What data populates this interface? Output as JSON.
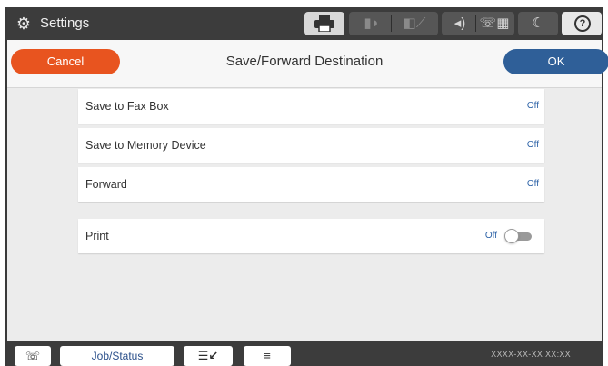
{
  "topbar": {
    "title": "Settings",
    "icons": {
      "settings": "gear-icon",
      "printer": "printer-icon",
      "wifi": "wifi-icon",
      "wifi_direct": "wifi-direct-icon",
      "volume": "volume-icon",
      "fax": "fax-icon",
      "sleep": "moon-icon",
      "help": "help-icon"
    },
    "help_glyph": "?"
  },
  "header": {
    "cancel_label": "Cancel",
    "title": "Save/Forward Destination",
    "ok_label": "OK"
  },
  "items": [
    {
      "label": "Save to Fax Box",
      "value": "Off"
    },
    {
      "label": "Save to Memory Device",
      "value": "Off"
    },
    {
      "label": "Forward",
      "value": "Off"
    }
  ],
  "print": {
    "label": "Print",
    "value": "Off",
    "enabled": false
  },
  "bottombar": {
    "job_status_label": "Job/Status",
    "date": "XXXX-XX-XX XX:XX"
  },
  "colors": {
    "cancel": "#e8541f",
    "ok": "#2f5f98",
    "value_text": "#2f64a8",
    "bars": "#3c3c3c"
  }
}
